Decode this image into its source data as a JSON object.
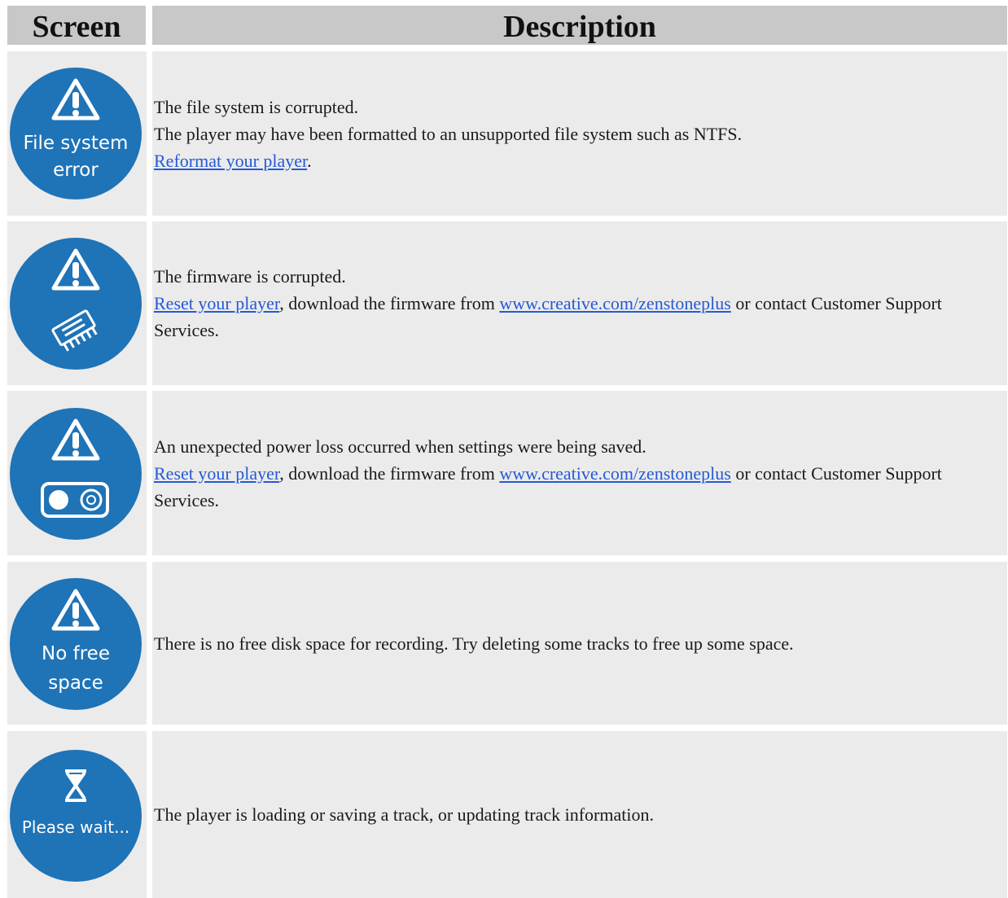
{
  "header": {
    "screen": "Screen",
    "description": "Description"
  },
  "rows": [
    {
      "icon": "file-system-error",
      "icon_lines": [
        "File system",
        "error"
      ],
      "lines": [
        {
          "text": "The file system is corrupted."
        },
        {
          "text": "The player may have been formatted to an unsupported file system such as NTFS."
        },
        {
          "link": "Reformat your player",
          "after": "."
        }
      ]
    },
    {
      "icon": "firmware-chip",
      "lines": [
        {
          "text": "The firmware is corrupted."
        },
        {
          "link": "Reset your player",
          "mid": ", download the firmware from ",
          "link2": "www.creative.com/zenstoneplus",
          "after": " or contact Customer Support Services."
        }
      ]
    },
    {
      "icon": "power-toggle",
      "lines": [
        {
          "text": "An unexpected power loss occurred when settings were being saved."
        },
        {
          "link": "Reset your player",
          "mid": ", download the firmware from ",
          "link2": "www.creative.com/zenstoneplus",
          "after": " or contact Customer Support Services."
        }
      ]
    },
    {
      "icon": "no-free-space",
      "icon_lines": [
        "No free",
        "space"
      ],
      "lines": [
        {
          "text": "There is no free disk space for recording. Try deleting some tracks to free up some space."
        }
      ]
    },
    {
      "icon": "hourglass",
      "icon_lines": [
        "Please wait..."
      ],
      "lines": [
        {
          "text": "The player is loading or saving a track, or updating track information."
        }
      ]
    }
  ],
  "colors": {
    "icon_blue": "#1f73b7",
    "link": "#2559d6",
    "header_bg": "#c8c8c8",
    "cell_bg": "#ebebeb"
  }
}
